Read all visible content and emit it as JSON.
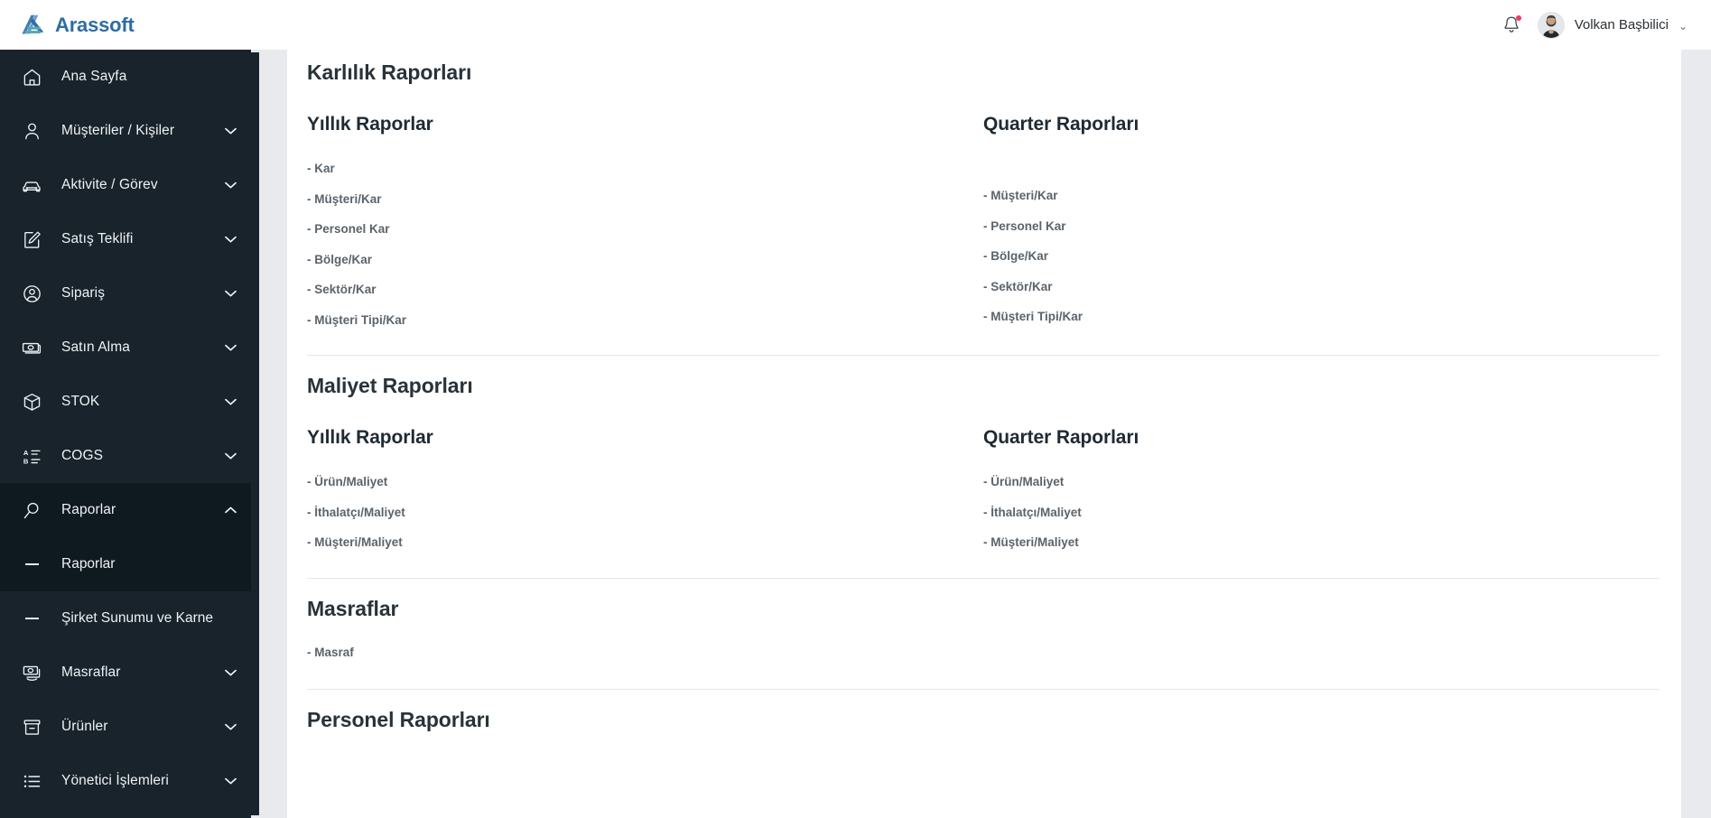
{
  "brand": {
    "name": "Arassoft",
    "logo_icon": "arassoft-logo-icon",
    "colors": {
      "dark": "#2e6ca4",
      "light": "#57a3b8"
    }
  },
  "topbar": {
    "notifications_icon": "bell-icon",
    "has_unread": true,
    "unread_dot_color": "#ef3b5b",
    "avatar_icon": "user-avatar",
    "user_name": "Volkan Başbilici",
    "caret_icon": "chevron-down-icon"
  },
  "sidebar": {
    "background": "#18232b",
    "active_background": "#0f1920",
    "items": [
      {
        "label": "Ana Sayfa",
        "icon": "home-icon",
        "has_chevron": false,
        "active": false
      },
      {
        "label": "Müşteriler / Kişiler",
        "icon": "person-icon",
        "has_chevron": true,
        "active": false
      },
      {
        "label": "Aktivite / Görev",
        "icon": "car-icon",
        "has_chevron": true,
        "active": false
      },
      {
        "label": "Satış Teklifi",
        "icon": "edit-note-icon",
        "has_chevron": true,
        "active": false
      },
      {
        "label": "Sipariş",
        "icon": "user-circle-icon",
        "has_chevron": true,
        "active": false
      },
      {
        "label": "Satın Alma",
        "icon": "banknote-icon",
        "has_chevron": true,
        "active": false
      },
      {
        "label": "STOK",
        "icon": "cube-icon",
        "has_chevron": true,
        "active": false
      },
      {
        "label": "COGS",
        "icon": "list-ab-icon",
        "has_chevron": true,
        "active": false
      },
      {
        "label": "Raporlar",
        "icon": "magnifier-icon",
        "has_chevron": true,
        "active": true,
        "expanded": true
      }
    ],
    "submenu": [
      {
        "label": "Raporlar",
        "icon": "dash-icon",
        "active": true
      },
      {
        "label": "Şirket Sunumu ve Karne",
        "icon": "dash-icon",
        "active": false
      }
    ],
    "items_after": [
      {
        "label": "Masraflar",
        "icon": "money-icon",
        "has_chevron": true,
        "active": false
      },
      {
        "label": "Ürünler",
        "icon": "archive-icon",
        "has_chevron": true,
        "active": false
      },
      {
        "label": "Yönetici İşlemleri",
        "icon": "bullet-list-icon",
        "has_chevron": true,
        "active": false
      }
    ]
  },
  "main": {
    "sections": [
      {
        "title": "Karlılık Raporları",
        "columns": [
          {
            "heading": "Yıllık Raporlar",
            "links": [
              "- Kar",
              "- Müşteri/Kar",
              "- Personel Kar",
              "- Bölge/Kar",
              "- Sektör/Kar",
              "- Müşteri Tipi/Kar"
            ]
          },
          {
            "heading": "Quarter Raporları",
            "links": [
              "- Müşteri/Kar",
              "- Personel Kar",
              "- Bölge/Kar",
              "- Sektör/Kar",
              "- Müşteri Tipi/Kar"
            ]
          }
        ]
      },
      {
        "title": "Maliyet Raporları",
        "columns": [
          {
            "heading": "Yıllık Raporlar",
            "links": [
              "- Ürün/Maliyet",
              "- İthalatçı/Maliyet",
              "- Müşteri/Maliyet"
            ]
          },
          {
            "heading": "Quarter Raporları",
            "links": [
              "- Ürün/Maliyet",
              "- İthalatçı/Maliyet",
              "- Müşteri/Maliyet"
            ]
          }
        ]
      },
      {
        "title": "Masraflar",
        "columns": [
          {
            "heading": "",
            "links": [
              "- Masraf"
            ]
          }
        ]
      },
      {
        "title": "Personel Raporları",
        "columns": []
      }
    ]
  }
}
